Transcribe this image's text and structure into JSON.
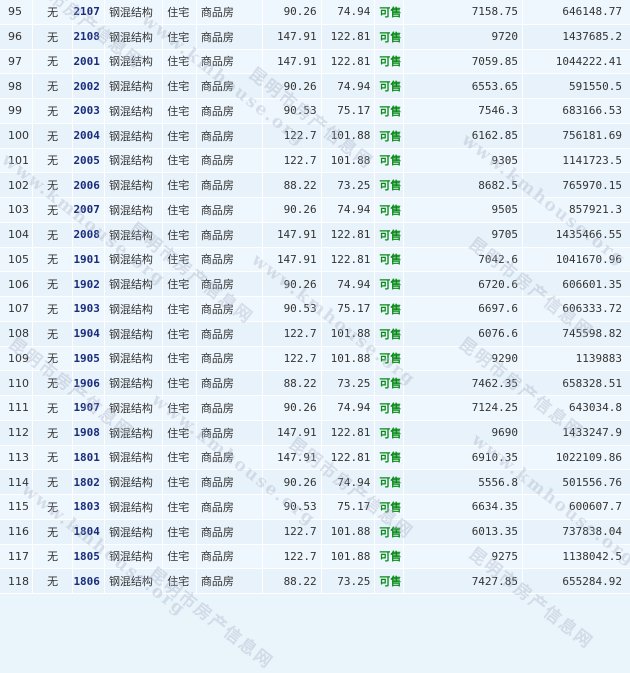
{
  "watermark": {
    "text": "昆明市房产信息网",
    "url": "www.kmhouse.org"
  },
  "rows": [
    {
      "idx": "95",
      "no": "无",
      "room": "2107",
      "struct": "钢混结构",
      "use": "住宅",
      "type": "商品房",
      "area1": "90.26",
      "area2": "74.94",
      "status": "可售",
      "price": "7158.75",
      "total": "646148.77"
    },
    {
      "idx": "96",
      "no": "无",
      "room": "2108",
      "struct": "钢混结构",
      "use": "住宅",
      "type": "商品房",
      "area1": "147.91",
      "area2": "122.81",
      "status": "可售",
      "price": "9720",
      "total": "1437685.2"
    },
    {
      "idx": "97",
      "no": "无",
      "room": "2001",
      "struct": "钢混结构",
      "use": "住宅",
      "type": "商品房",
      "area1": "147.91",
      "area2": "122.81",
      "status": "可售",
      "price": "7059.85",
      "total": "1044222.41"
    },
    {
      "idx": "98",
      "no": "无",
      "room": "2002",
      "struct": "钢混结构",
      "use": "住宅",
      "type": "商品房",
      "area1": "90.26",
      "area2": "74.94",
      "status": "可售",
      "price": "6553.65",
      "total": "591550.5"
    },
    {
      "idx": "99",
      "no": "无",
      "room": "2003",
      "struct": "钢混结构",
      "use": "住宅",
      "type": "商品房",
      "area1": "90.53",
      "area2": "75.17",
      "status": "可售",
      "price": "7546.3",
      "total": "683166.53"
    },
    {
      "idx": "100",
      "no": "无",
      "room": "2004",
      "struct": "钢混结构",
      "use": "住宅",
      "type": "商品房",
      "area1": "122.7",
      "area2": "101.88",
      "status": "可售",
      "price": "6162.85",
      "total": "756181.69"
    },
    {
      "idx": "101",
      "no": "无",
      "room": "2005",
      "struct": "钢混结构",
      "use": "住宅",
      "type": "商品房",
      "area1": "122.7",
      "area2": "101.88",
      "status": "可售",
      "price": "9305",
      "total": "1141723.5"
    },
    {
      "idx": "102",
      "no": "无",
      "room": "2006",
      "struct": "钢混结构",
      "use": "住宅",
      "type": "商品房",
      "area1": "88.22",
      "area2": "73.25",
      "status": "可售",
      "price": "8682.5",
      "total": "765970.15"
    },
    {
      "idx": "103",
      "no": "无",
      "room": "2007",
      "struct": "钢混结构",
      "use": "住宅",
      "type": "商品房",
      "area1": "90.26",
      "area2": "74.94",
      "status": "可售",
      "price": "9505",
      "total": "857921.3"
    },
    {
      "idx": "104",
      "no": "无",
      "room": "2008",
      "struct": "钢混结构",
      "use": "住宅",
      "type": "商品房",
      "area1": "147.91",
      "area2": "122.81",
      "status": "可售",
      "price": "9705",
      "total": "1435466.55"
    },
    {
      "idx": "105",
      "no": "无",
      "room": "1901",
      "struct": "钢混结构",
      "use": "住宅",
      "type": "商品房",
      "area1": "147.91",
      "area2": "122.81",
      "status": "可售",
      "price": "7042.6",
      "total": "1041670.96"
    },
    {
      "idx": "106",
      "no": "无",
      "room": "1902",
      "struct": "钢混结构",
      "use": "住宅",
      "type": "商品房",
      "area1": "90.26",
      "area2": "74.94",
      "status": "可售",
      "price": "6720.6",
      "total": "606601.35"
    },
    {
      "idx": "107",
      "no": "无",
      "room": "1903",
      "struct": "钢混结构",
      "use": "住宅",
      "type": "商品房",
      "area1": "90.53",
      "area2": "75.17",
      "status": "可售",
      "price": "6697.6",
      "total": "606333.72"
    },
    {
      "idx": "108",
      "no": "无",
      "room": "1904",
      "struct": "钢混结构",
      "use": "住宅",
      "type": "商品房",
      "area1": "122.7",
      "area2": "101.88",
      "status": "可售",
      "price": "6076.6",
      "total": "745598.82"
    },
    {
      "idx": "109",
      "no": "无",
      "room": "1905",
      "struct": "钢混结构",
      "use": "住宅",
      "type": "商品房",
      "area1": "122.7",
      "area2": "101.88",
      "status": "可售",
      "price": "9290",
      "total": "1139883"
    },
    {
      "idx": "110",
      "no": "无",
      "room": "1906",
      "struct": "钢混结构",
      "use": "住宅",
      "type": "商品房",
      "area1": "88.22",
      "area2": "73.25",
      "status": "可售",
      "price": "7462.35",
      "total": "658328.51"
    },
    {
      "idx": "111",
      "no": "无",
      "room": "1907",
      "struct": "钢混结构",
      "use": "住宅",
      "type": "商品房",
      "area1": "90.26",
      "area2": "74.94",
      "status": "可售",
      "price": "7124.25",
      "total": "643034.8"
    },
    {
      "idx": "112",
      "no": "无",
      "room": "1908",
      "struct": "钢混结构",
      "use": "住宅",
      "type": "商品房",
      "area1": "147.91",
      "area2": "122.81",
      "status": "可售",
      "price": "9690",
      "total": "1433247.9"
    },
    {
      "idx": "113",
      "no": "无",
      "room": "1801",
      "struct": "钢混结构",
      "use": "住宅",
      "type": "商品房",
      "area1": "147.91",
      "area2": "122.81",
      "status": "可售",
      "price": "6910.35",
      "total": "1022109.86"
    },
    {
      "idx": "114",
      "no": "无",
      "room": "1802",
      "struct": "钢混结构",
      "use": "住宅",
      "type": "商品房",
      "area1": "90.26",
      "area2": "74.94",
      "status": "可售",
      "price": "5556.8",
      "total": "501556.76"
    },
    {
      "idx": "115",
      "no": "无",
      "room": "1803",
      "struct": "钢混结构",
      "use": "住宅",
      "type": "商品房",
      "area1": "90.53",
      "area2": "75.17",
      "status": "可售",
      "price": "6634.35",
      "total": "600607.7"
    },
    {
      "idx": "116",
      "no": "无",
      "room": "1804",
      "struct": "钢混结构",
      "use": "住宅",
      "type": "商品房",
      "area1": "122.7",
      "area2": "101.88",
      "status": "可售",
      "price": "6013.35",
      "total": "737838.04"
    },
    {
      "idx": "117",
      "no": "无",
      "room": "1805",
      "struct": "钢混结构",
      "use": "住宅",
      "type": "商品房",
      "area1": "122.7",
      "area2": "101.88",
      "status": "可售",
      "price": "9275",
      "total": "1138042.5"
    },
    {
      "idx": "118",
      "no": "无",
      "room": "1806",
      "struct": "钢混结构",
      "use": "住宅",
      "type": "商品房",
      "area1": "88.22",
      "area2": "73.25",
      "status": "可售",
      "price": "7427.85",
      "total": "655284.92"
    }
  ],
  "colors": {
    "room_link": "#1a2c7c",
    "status_available": "#0a8a18",
    "row_bg": "#e7f2fa"
  }
}
